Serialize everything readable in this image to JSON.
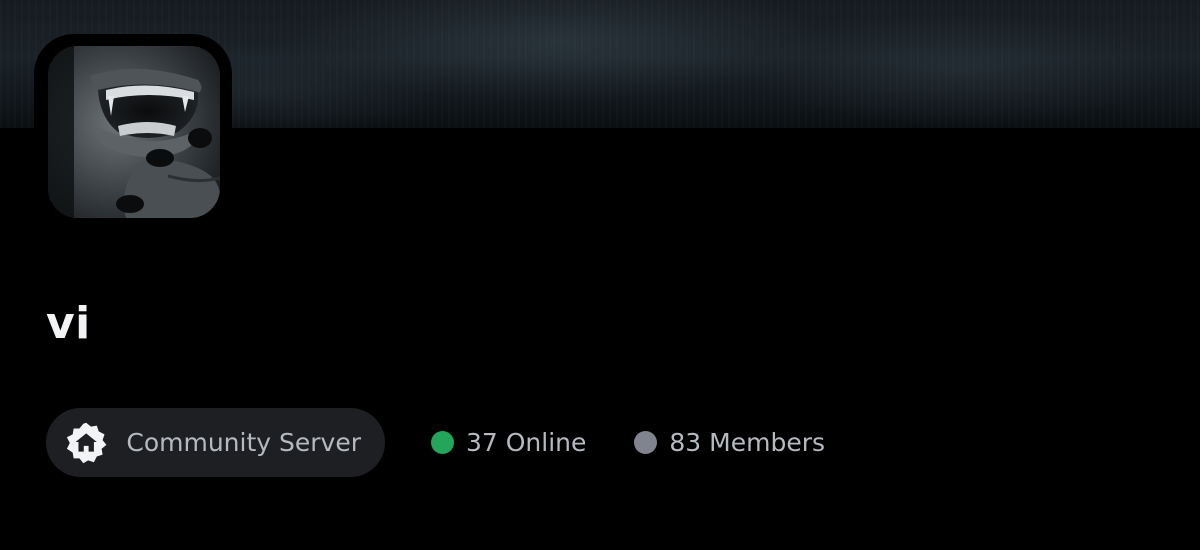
{
  "server": {
    "name": "vi",
    "avatar_icon": "server-avatar-image"
  },
  "stats": {
    "community_label": "Community Server",
    "community_icon": "community-house-badge-icon",
    "online_label": "37 Online",
    "members_label": "83 Members"
  },
  "colors": {
    "background": "#000000",
    "pill_background": "#1e1f22",
    "online_dot": "#23a55a",
    "members_dot": "#80848e",
    "title_text": "#f2f3f5",
    "secondary_text": "#b5bac1"
  }
}
